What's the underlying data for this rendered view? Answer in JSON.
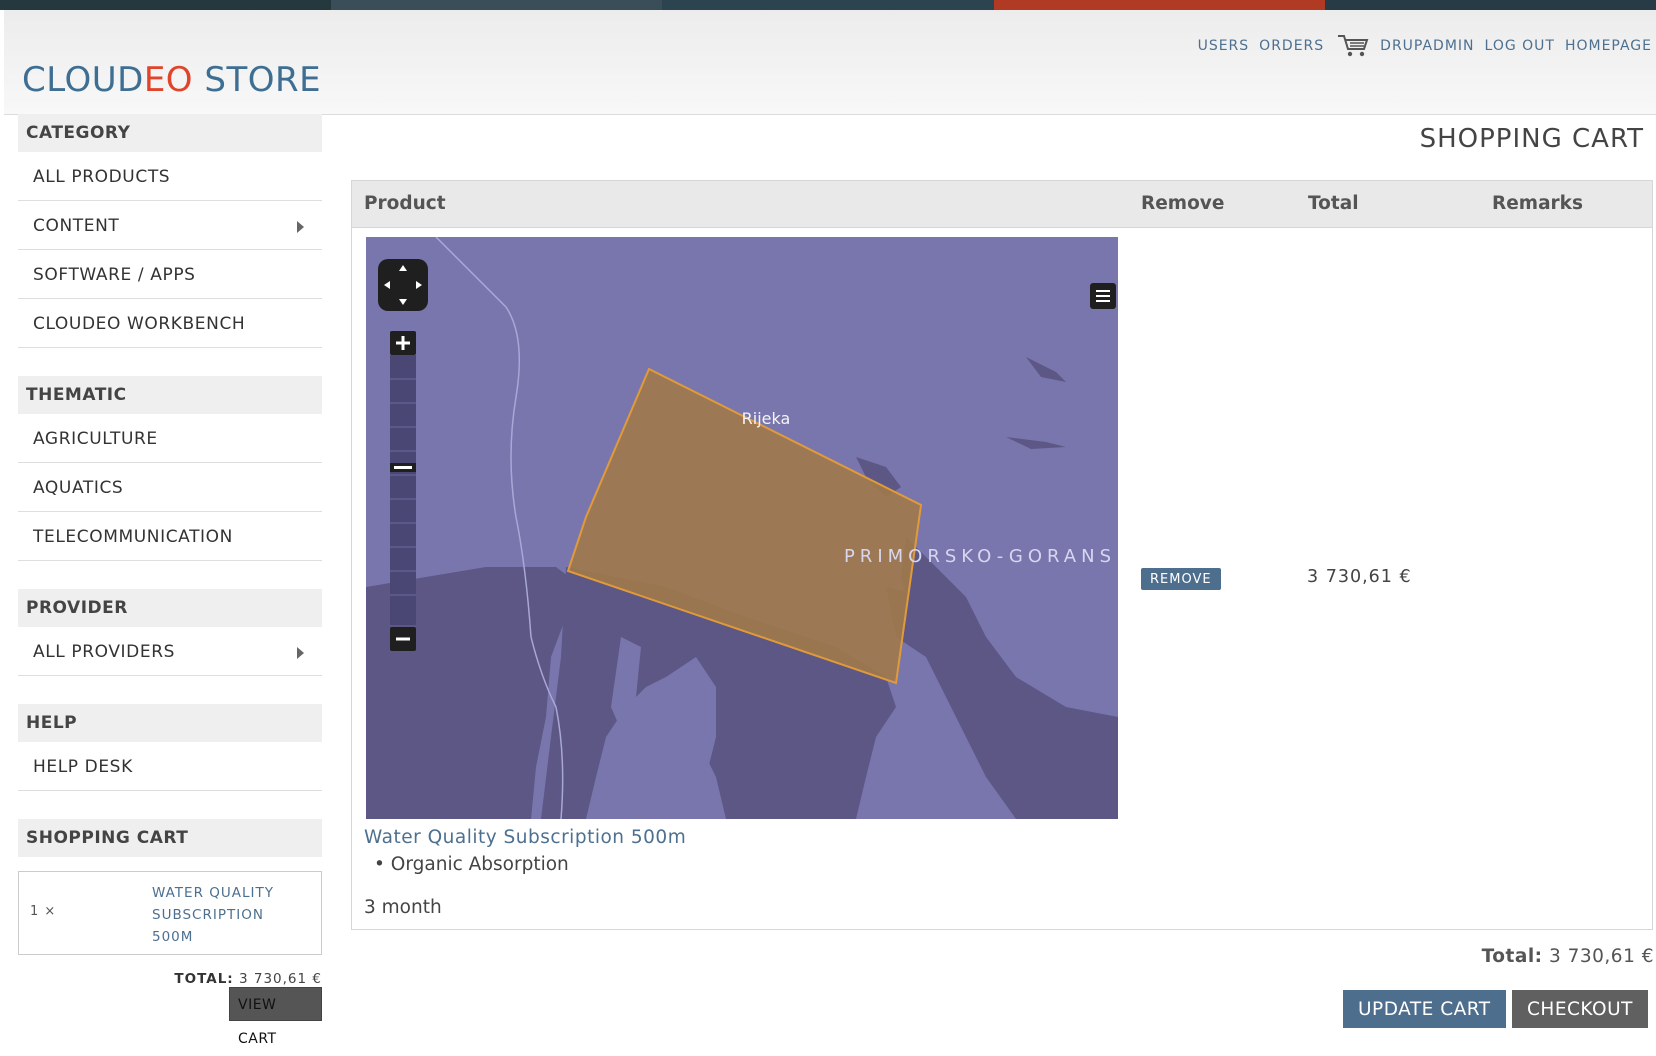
{
  "site": {
    "logo_part1": "CLOUD",
    "logo_part2": "EO",
    "logo_part3": " STORE"
  },
  "topnav": {
    "users": "USERS",
    "orders": "ORDERS",
    "user": "DRUPADMIN",
    "logout": "LOG OUT",
    "homepage": "HOMEPAGE"
  },
  "sidebar": {
    "category_title": "CATEGORY",
    "category_items": [
      "ALL PRODUCTS",
      "CONTENT",
      "SOFTWARE / APPS",
      "CLOUDEO WORKBENCH"
    ],
    "thematic_title": "THEMATIC",
    "thematic_items": [
      "AGRICULTURE",
      "AQUATICS",
      "TELECOMMUNICATION"
    ],
    "provider_title": "PROVIDER",
    "provider_items": [
      "ALL PROVIDERS"
    ],
    "help_title": "HELP",
    "help_items": [
      "HELP DESK"
    ],
    "cart_title": "SHOPPING CART",
    "cart_qty": "1 ×",
    "cart_product": "WATER QUALITY SUBSCRIPTION 500M",
    "cart_total_label": "TOTAL:",
    "cart_total_value": " 3 730,61 €",
    "view_cart": "VIEW CART"
  },
  "main": {
    "title": "SHOPPING CART",
    "columns": [
      "Product",
      "Remove",
      "Total",
      "Remarks"
    ],
    "row": {
      "map_city": "Rijeka",
      "map_region": "PRIMORSKO-GORANS",
      "product_name": "Water Quality Subscription 500m",
      "attribute": "Organic Absorption",
      "duration": "3 month",
      "remove_label": "REMOVE",
      "total": "3 730,61 €"
    },
    "grand_total_label": "Total:",
    "grand_total_value": " 3 730,61 €",
    "update_label": "UPDATE CART",
    "checkout_label": "CHECKOUT"
  },
  "colors": {
    "accent": "#4e6e8e",
    "logo_blue": "#3e6e92",
    "logo_red": "#e0452b",
    "map_sea": "#7976ae",
    "map_land": "#5c5785",
    "aoi_fill": "#a07a4a"
  }
}
